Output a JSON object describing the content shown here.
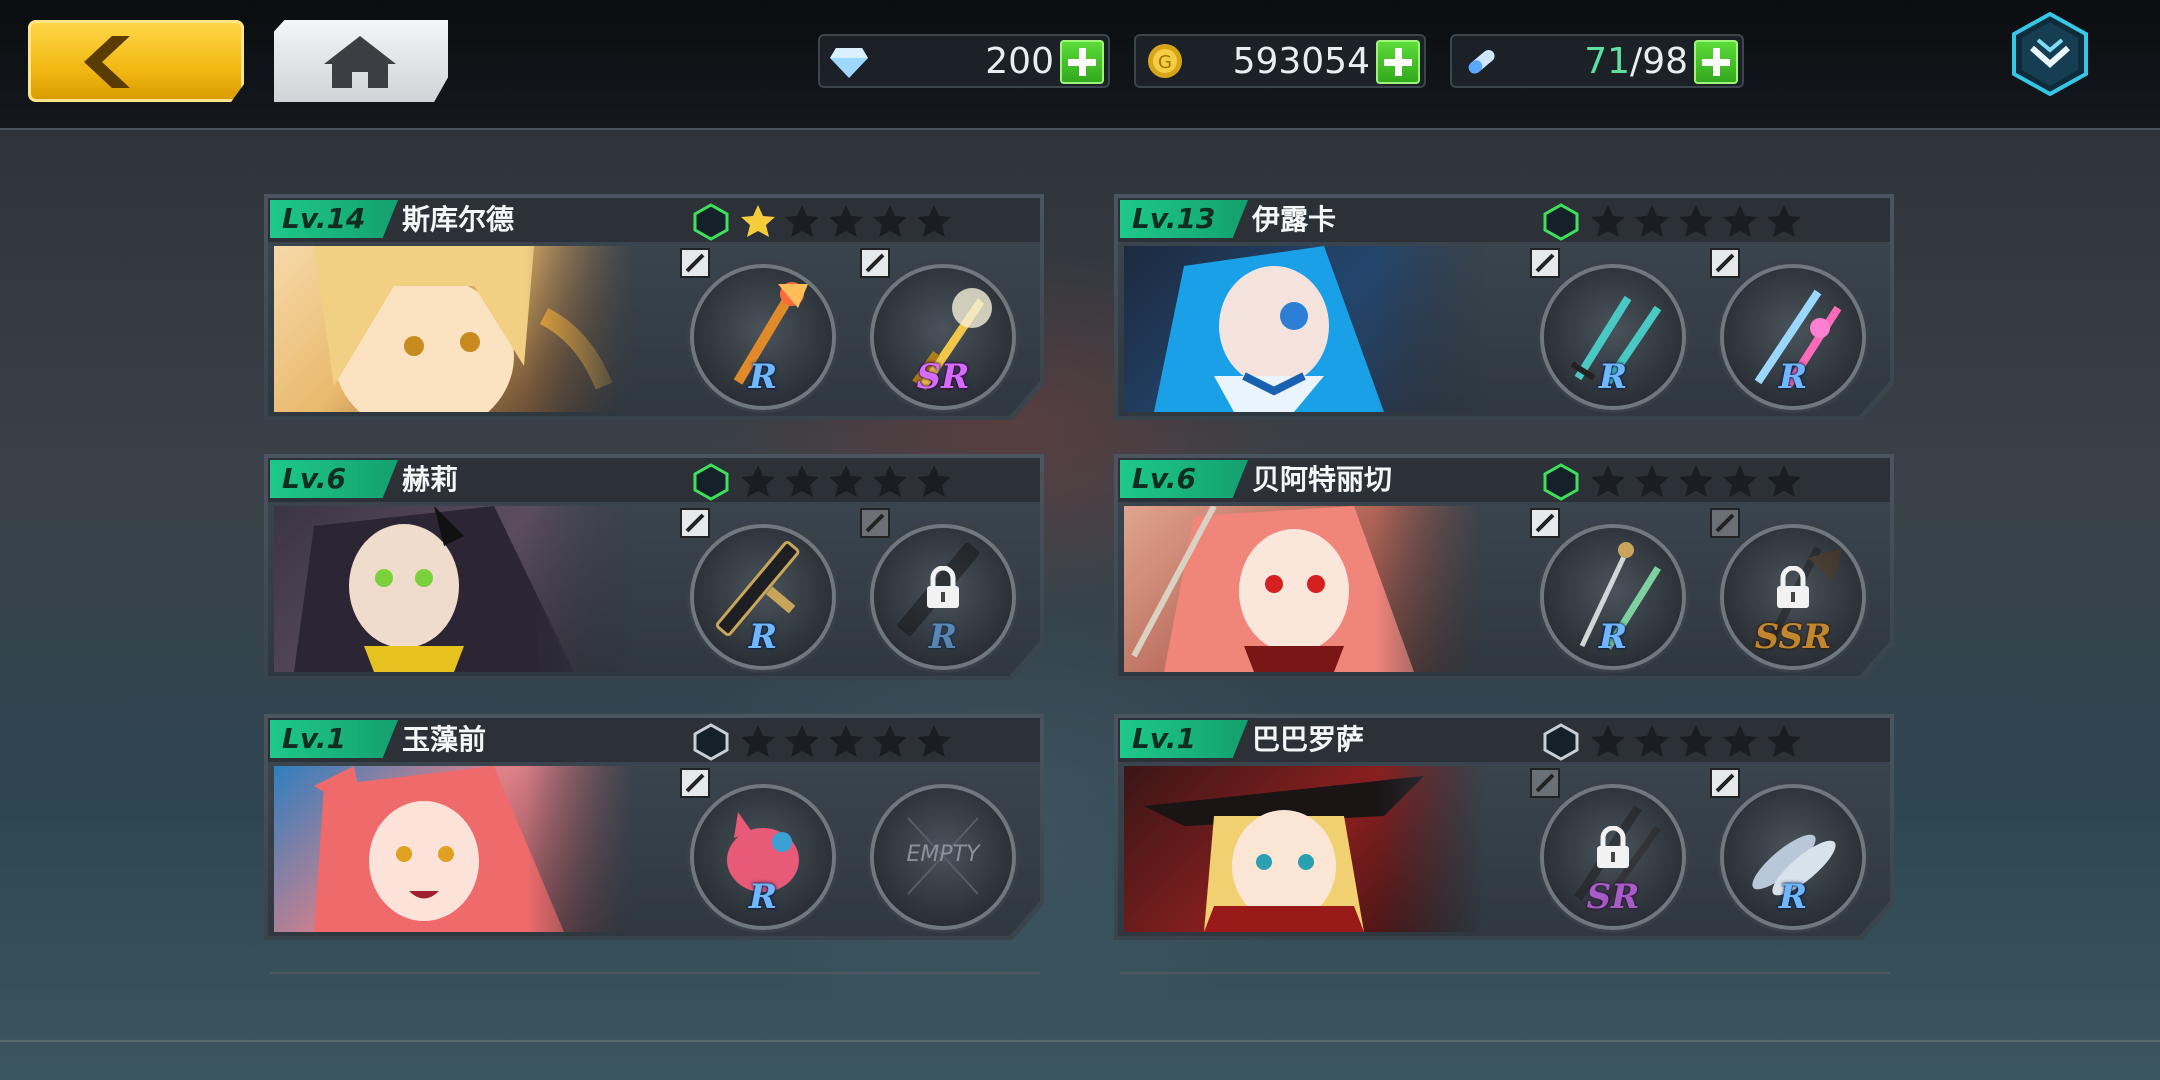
{
  "currency": {
    "gems": "200",
    "gold": "593054",
    "stamina_current": "71",
    "stamina_separator": "/",
    "stamina_max": "98"
  },
  "colors": {
    "accent_green": "#1ec98a",
    "gold_button": "#f2b812",
    "rarity_R": "#6fb7ff",
    "rarity_SR": "#d86bff",
    "rarity_SSR": "#e69a2c"
  },
  "characters": [
    {
      "level": "Lv.14",
      "name": "斯库尔德",
      "stars": 1,
      "slots": [
        {
          "rarity": "R",
          "locked": false,
          "icon": "staff-icon"
        },
        {
          "rarity": "SR",
          "locked": false,
          "icon": "sword-icon"
        }
      ]
    },
    {
      "level": "Lv.13",
      "name": "伊露卡",
      "stars": 0,
      "slots": [
        {
          "rarity": "R",
          "locked": false,
          "icon": "dual-blades-icon"
        },
        {
          "rarity": "R",
          "locked": false,
          "icon": "lance-icon"
        }
      ]
    },
    {
      "level": "Lv.6",
      "name": "赫莉",
      "stars": 0,
      "slots": [
        {
          "rarity": "R",
          "locked": false,
          "icon": "rifle-icon"
        },
        {
          "rarity": "R",
          "locked": true,
          "icon": "rifle-icon"
        }
      ]
    },
    {
      "level": "Lv.6",
      "name": "贝阿特丽切",
      "stars": 0,
      "slots": [
        {
          "rarity": "R",
          "locked": false,
          "icon": "rapier-icon"
        },
        {
          "rarity": "SSR",
          "locked": true,
          "icon": "axe-icon"
        }
      ]
    },
    {
      "level": "Lv.1",
      "name": "玉藻前",
      "stars": 0,
      "slots": [
        {
          "rarity": "R",
          "locked": false,
          "icon": "pet-icon"
        },
        {
          "rarity": "EMPTY",
          "locked": false,
          "icon": "empty-slot-icon"
        }
      ]
    },
    {
      "level": "Lv.1",
      "name": "巴巴罗萨",
      "stars": 0,
      "slots": [
        {
          "rarity": "SR",
          "locked": true,
          "icon": "musket-icon"
        },
        {
          "rarity": "R",
          "locked": false,
          "icon": "fish-icon"
        }
      ]
    }
  ]
}
